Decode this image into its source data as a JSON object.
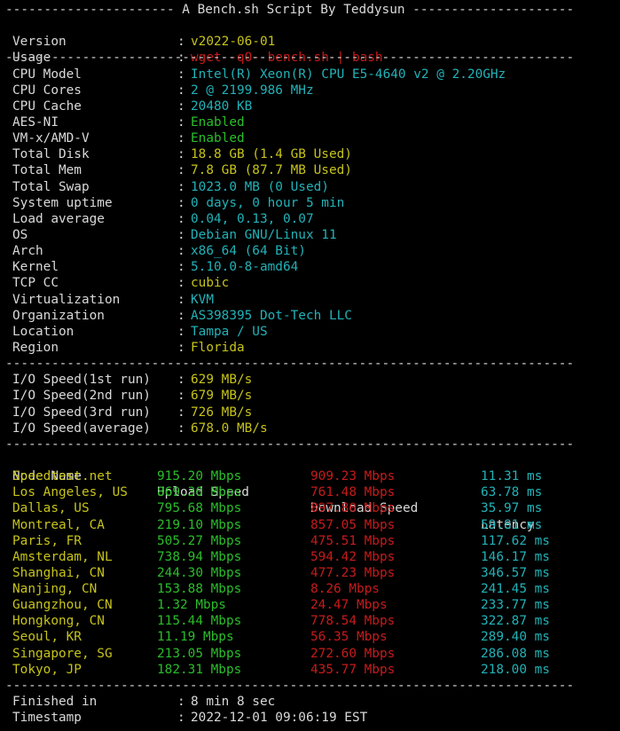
{
  "header": {
    "top_rule": "---------------------- A Bench.sh Script By Teddysun ---------------------",
    "rule": "--------------------------------------------------------------------------"
  },
  "meta": [
    {
      "key": "Version",
      "value": "v2022-06-01",
      "color": "yellow"
    },
    {
      "key": "Usage",
      "value": "wget -qO- bench.sh | bash",
      "color": "red"
    }
  ],
  "system": [
    {
      "key": "CPU Model",
      "value": "Intel(R) Xeon(R) CPU E5-4640 v2 @ 2.20GHz",
      "color": "cyan"
    },
    {
      "key": "CPU Cores",
      "value": "2 @ 2199.986 MHz",
      "color": "cyan"
    },
    {
      "key": "CPU Cache",
      "value": "20480 KB",
      "color": "cyan"
    },
    {
      "key": "AES-NI",
      "value": "Enabled",
      "color": "green"
    },
    {
      "key": "VM-x/AMD-V",
      "value": "Enabled",
      "color": "green"
    },
    {
      "key": "Total Disk",
      "value": "18.8 GB (1.4 GB Used)",
      "color": "yellow"
    },
    {
      "key": "Total Mem",
      "value": "7.8 GB (87.7 MB Used)",
      "color": "yellow"
    },
    {
      "key": "Total Swap",
      "value": "1023.0 MB (0 Used)",
      "color": "cyan"
    },
    {
      "key": "System uptime",
      "value": "0 days, 0 hour 5 min",
      "color": "cyan"
    },
    {
      "key": "Load average",
      "value": "0.04, 0.13, 0.07",
      "color": "cyan"
    },
    {
      "key": "OS",
      "value": "Debian GNU/Linux 11",
      "color": "cyan"
    },
    {
      "key": "Arch",
      "value": "x86_64 (64 Bit)",
      "color": "cyan"
    },
    {
      "key": "Kernel",
      "value": "5.10.0-8-amd64",
      "color": "cyan"
    },
    {
      "key": "TCP CC",
      "value": "cubic",
      "color": "yellow"
    },
    {
      "key": "Virtualization",
      "value": "KVM",
      "color": "cyan"
    },
    {
      "key": "Organization",
      "value": "AS398395 Dot-Tech LLC",
      "color": "cyan"
    },
    {
      "key": "Location",
      "value": "Tampa / US",
      "color": "cyan"
    },
    {
      "key": "Region",
      "value": "Florida",
      "color": "yellow"
    }
  ],
  "io": [
    {
      "key": "I/O Speed(1st run)",
      "value": "629 MB/s",
      "color": "yellow"
    },
    {
      "key": "I/O Speed(2nd run)",
      "value": "679 MB/s",
      "color": "yellow"
    },
    {
      "key": "I/O Speed(3rd run)",
      "value": "726 MB/s",
      "color": "yellow"
    },
    {
      "key": "I/O Speed(average)",
      "value": "678.0 MB/s",
      "color": "yellow"
    }
  ],
  "speed_table": {
    "headers": [
      "Node Name",
      "Upload Speed",
      "Download Speed",
      "Latency"
    ],
    "rows": [
      [
        "Speedtest.net",
        "915.20 Mbps",
        "909.23 Mbps",
        "11.31 ms"
      ],
      [
        "Los Angeles, US",
        "869.30 Mbps",
        "761.48 Mbps",
        "63.78 ms"
      ],
      [
        "Dallas, US",
        "795.68 Mbps",
        "897.80 Mbps",
        "35.97 ms"
      ],
      [
        "Montreal, CA",
        "219.10 Mbps",
        "857.05 Mbps",
        "59.81 ms"
      ],
      [
        "Paris, FR",
        "505.27 Mbps",
        "475.51 Mbps",
        "117.62 ms"
      ],
      [
        "Amsterdam, NL",
        "738.94 Mbps",
        "594.42 Mbps",
        "146.17 ms"
      ],
      [
        "Shanghai, CN",
        "244.30 Mbps",
        "477.23 Mbps",
        "346.57 ms"
      ],
      [
        "Nanjing, CN",
        "153.88 Mbps",
        "8.26 Mbps",
        "241.45 ms"
      ],
      [
        "Guangzhou, CN",
        "1.32 Mbps",
        "24.47 Mbps",
        "233.77 ms"
      ],
      [
        "Hongkong, CN",
        "115.44 Mbps",
        "778.54 Mbps",
        "322.87 ms"
      ],
      [
        "Seoul, KR",
        "11.19 Mbps",
        "56.35 Mbps",
        "289.40 ms"
      ],
      [
        "Singapore, SG",
        "213.05 Mbps",
        "272.60 Mbps",
        "286.08 ms"
      ],
      [
        "Tokyo, JP",
        "182.31 Mbps",
        "435.77 Mbps",
        "218.00 ms"
      ]
    ]
  },
  "footer": [
    {
      "key": "Finished in",
      "value": "8 min 8 sec",
      "color": "white"
    },
    {
      "key": "Timestamp",
      "value": "2022-12-01 09:06:19 EST",
      "color": "white"
    }
  ],
  "colors": {
    "white": "#d9d9d9",
    "yellow": "#c6c31b",
    "cyan": "#22b2b8",
    "green": "#2bbd2b",
    "red": "#c71b1b",
    "background": "#000000"
  }
}
